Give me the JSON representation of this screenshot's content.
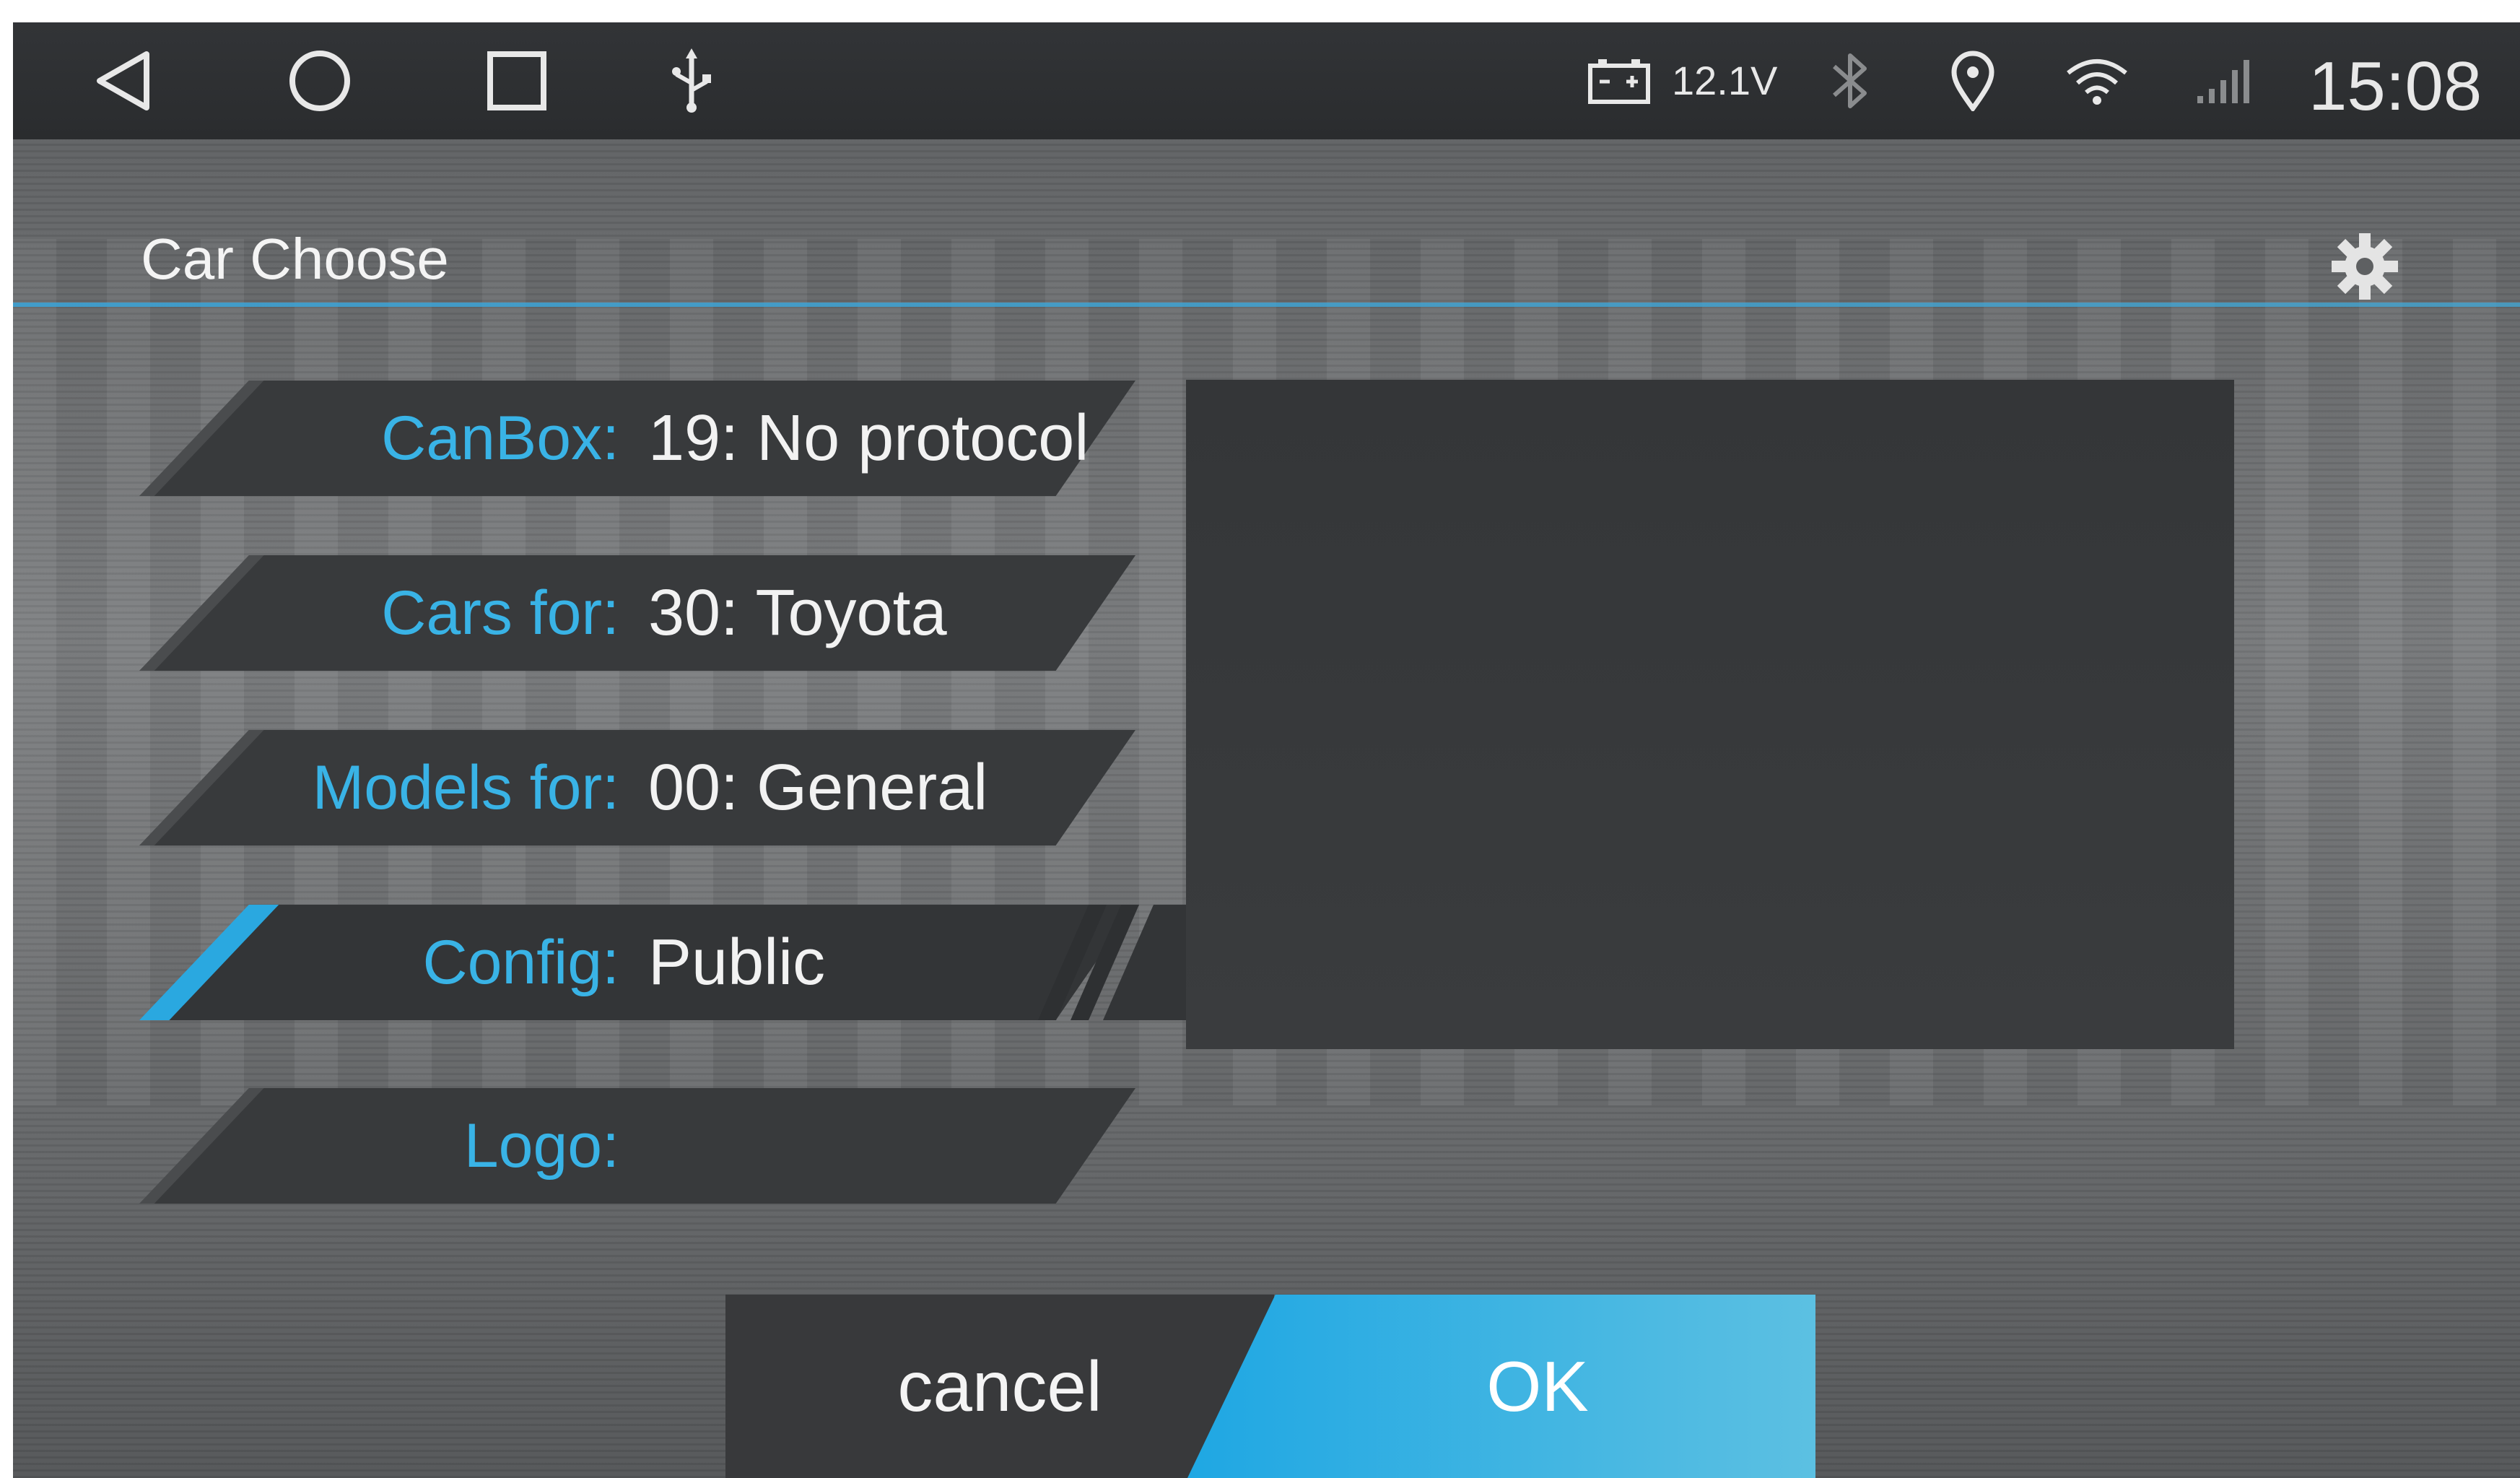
{
  "status_bar": {
    "nav": {
      "back_icon": "back-triangle-icon",
      "home_icon": "home-circle-icon",
      "recents_icon": "recents-square-icon",
      "usb_icon": "usb-icon"
    },
    "voltage": "12.1V",
    "time": "15:08",
    "indicators": [
      "battery-icon",
      "bluetooth-icon",
      "location-icon",
      "wifi-icon",
      "signal-icon"
    ]
  },
  "header": {
    "title": "Car Choose",
    "settings_icon": "gear-icon"
  },
  "rows": [
    {
      "label": "CanBox:",
      "value": "19: No protocol"
    },
    {
      "label": "Cars for:",
      "value": "30: Toyota"
    },
    {
      "label": "Models for:",
      "value": "00: General"
    },
    {
      "label": "Config:",
      "value": "Public"
    },
    {
      "label": "Logo:",
      "value": ""
    }
  ],
  "buttons": {
    "cancel": "cancel",
    "ok": "OK"
  },
  "colors": {
    "accent": "#39b3e6",
    "ok_button_start": "#1fa7e3",
    "ok_button_end": "#5cc0e2"
  }
}
